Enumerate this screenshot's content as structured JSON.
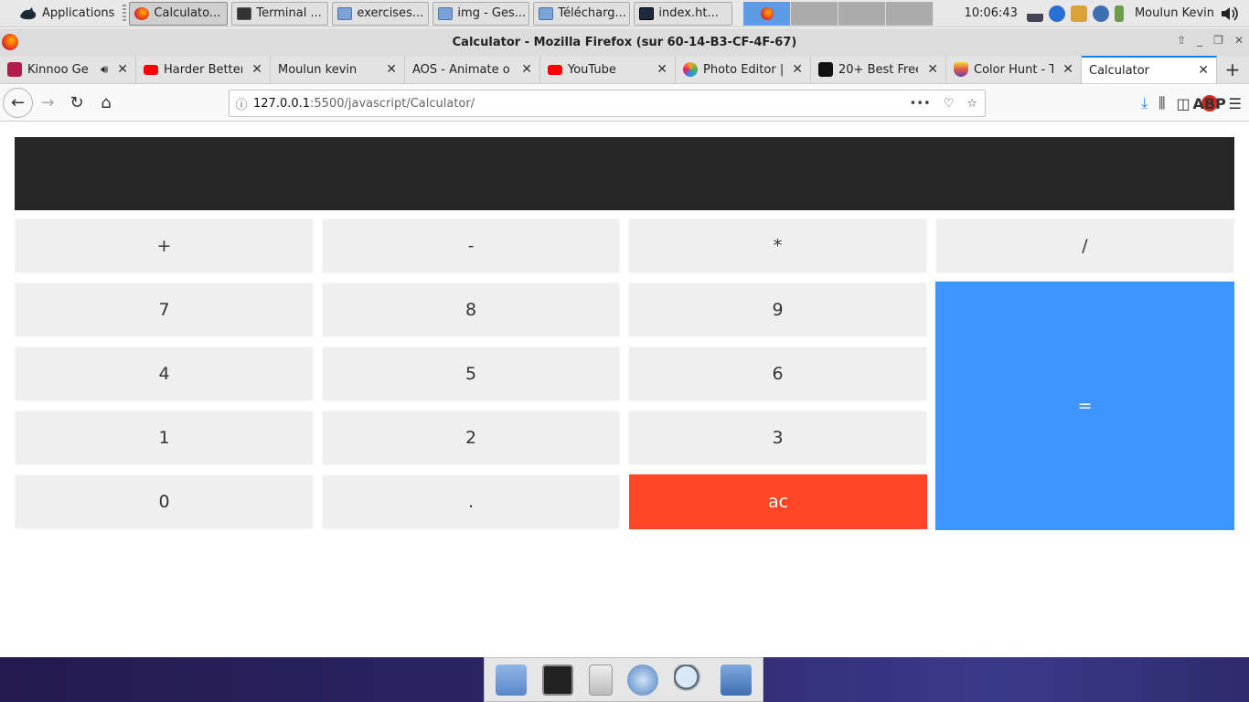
{
  "panel": {
    "menu_label": "Applications",
    "tasks": [
      {
        "label": "Calculato...",
        "icon": "firefox-icon"
      },
      {
        "label": "Terminal ...",
        "icon": "terminal-icon"
      },
      {
        "label": "exercises...",
        "icon": "folder-icon"
      },
      {
        "label": "img - Ges...",
        "icon": "folder-icon"
      },
      {
        "label": "Télécharg...",
        "icon": "folder-icon"
      },
      {
        "label": "index.ht...",
        "icon": "code-editor-icon"
      }
    ],
    "clock": "10:06:43",
    "user": "Moulun Kevin"
  },
  "window": {
    "title": "Calculator - Mozilla Firefox (sur 60-14-B3-CF-4F-67)"
  },
  "tabs": [
    {
      "label": "Kinnoo Ge",
      "favicon": "#b61a4a"
    },
    {
      "label": "Harder Better",
      "favicon": "#ff0000"
    },
    {
      "label": "Moulun kevin",
      "favicon": ""
    },
    {
      "label": "AOS - Animate o",
      "favicon": ""
    },
    {
      "label": "YouTube",
      "favicon": "#ff0000"
    },
    {
      "label": "Photo Editor |",
      "favicon": "#f5a623"
    },
    {
      "label": "20+ Best Free",
      "favicon": "#111111"
    },
    {
      "label": "Color Hunt - T",
      "favicon": "#6a3fb5"
    },
    {
      "label": "Calculator",
      "favicon": ""
    }
  ],
  "address": {
    "host": "127.0.0.1",
    "path": ":5500/javascript/Calculator/"
  },
  "calculator": {
    "display": "",
    "keys": {
      "plus": "+",
      "minus": "-",
      "multiply": "*",
      "divide": "/",
      "seven": "7",
      "eight": "8",
      "nine": "9",
      "four": "4",
      "five": "5",
      "six": "6",
      "one": "1",
      "two": "2",
      "three": "3",
      "zero": "0",
      "dot": ".",
      "clear": "ac",
      "equals": "="
    },
    "colors": {
      "display": "#262626",
      "key": "#efefef",
      "equals": "#3e95ff",
      "clear": "#ff4525"
    }
  }
}
